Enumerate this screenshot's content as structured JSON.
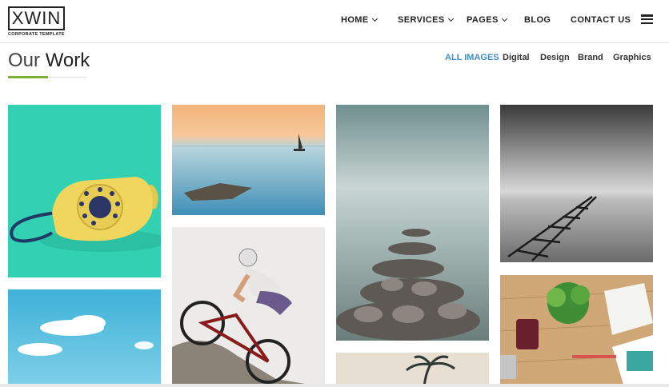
{
  "header": {
    "logo_text": "XWIN",
    "logo_tagline": "CORPORATE TEMPLATE",
    "nav": [
      {
        "label": "HOME",
        "has_dropdown": true
      },
      {
        "label": "SERVICES",
        "has_dropdown": true
      },
      {
        "label": "PAGES",
        "has_dropdown": true
      },
      {
        "label": "BLOG",
        "has_dropdown": false
      },
      {
        "label": "CONTACT US",
        "has_dropdown": false
      }
    ],
    "menu_icon": "hamburger-icon"
  },
  "section": {
    "title_light": "Our",
    "title_bold": "Work",
    "accent_color": "#7bb33a",
    "filters": [
      {
        "label": "ALL IMAGES",
        "active": true
      },
      {
        "label": "Digital",
        "active": false
      },
      {
        "label": "Design",
        "active": false
      },
      {
        "label": "Brand",
        "active": false
      },
      {
        "label": "Graphics",
        "active": false
      }
    ],
    "active_filter_color": "#3d8fc6"
  },
  "gallery": [
    {
      "name": "yellow-rotary-phone-image"
    },
    {
      "name": "sea-sunset-boat-image"
    },
    {
      "name": "foggy-sea-rocks-image"
    },
    {
      "name": "black-white-pier-image"
    },
    {
      "name": "blue-sky-clouds-image"
    },
    {
      "name": "mountain-biker-image"
    },
    {
      "name": "palm-tree-image"
    },
    {
      "name": "desk-workspace-image"
    }
  ]
}
